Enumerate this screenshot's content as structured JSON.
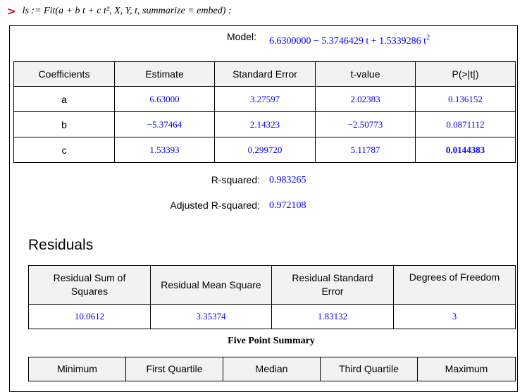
{
  "command": {
    "prompt_symbol": ">",
    "text": "ls := Fit(a + b t + c t², X, Y, t, summarize = embed) :"
  },
  "model": {
    "label": "Model:",
    "expression": "6.6300000 − 5.3746429 t + 1.5339286 t",
    "exponent": "2"
  },
  "coefficients_table": {
    "headers": [
      "Coefficients",
      "Estimate",
      "Standard Error",
      "t-value",
      "P(>|t|)"
    ],
    "rows": [
      {
        "name": "a",
        "estimate": "6.63000",
        "std_error": "3.27597",
        "t_value": "2.02383",
        "p_value": "0.136152"
      },
      {
        "name": "b",
        "estimate": "−5.37464",
        "std_error": "2.14323",
        "t_value": "−2.50773",
        "p_value": "0.0871112"
      },
      {
        "name": "c",
        "estimate": "1.53393",
        "std_error": "0.299720",
        "t_value": "5.11787",
        "p_value": "0.0144383"
      }
    ]
  },
  "r_squared": {
    "label": "R-squared:",
    "value": "0.983265"
  },
  "adjusted_r_squared": {
    "label": "Adjusted R-squared:",
    "value": "0.972108"
  },
  "residuals": {
    "title": "Residuals",
    "headers": [
      "Residual Sum of Squares",
      "Residual Mean Square",
      "Residual Standard Error",
      "Degrees of Freedom"
    ],
    "values": [
      "10.0612",
      "3.35374",
      "1.83132",
      "3"
    ]
  },
  "five_point_summary": {
    "caption": "Five Point Summary",
    "headers": [
      "Minimum",
      "First Quartile",
      "Median",
      "Third Quartile",
      "Maximum"
    ]
  },
  "colors": {
    "value_blue": "#0000ff",
    "prompt_red": "#c00000",
    "header_gray": "#f2f2f2"
  }
}
